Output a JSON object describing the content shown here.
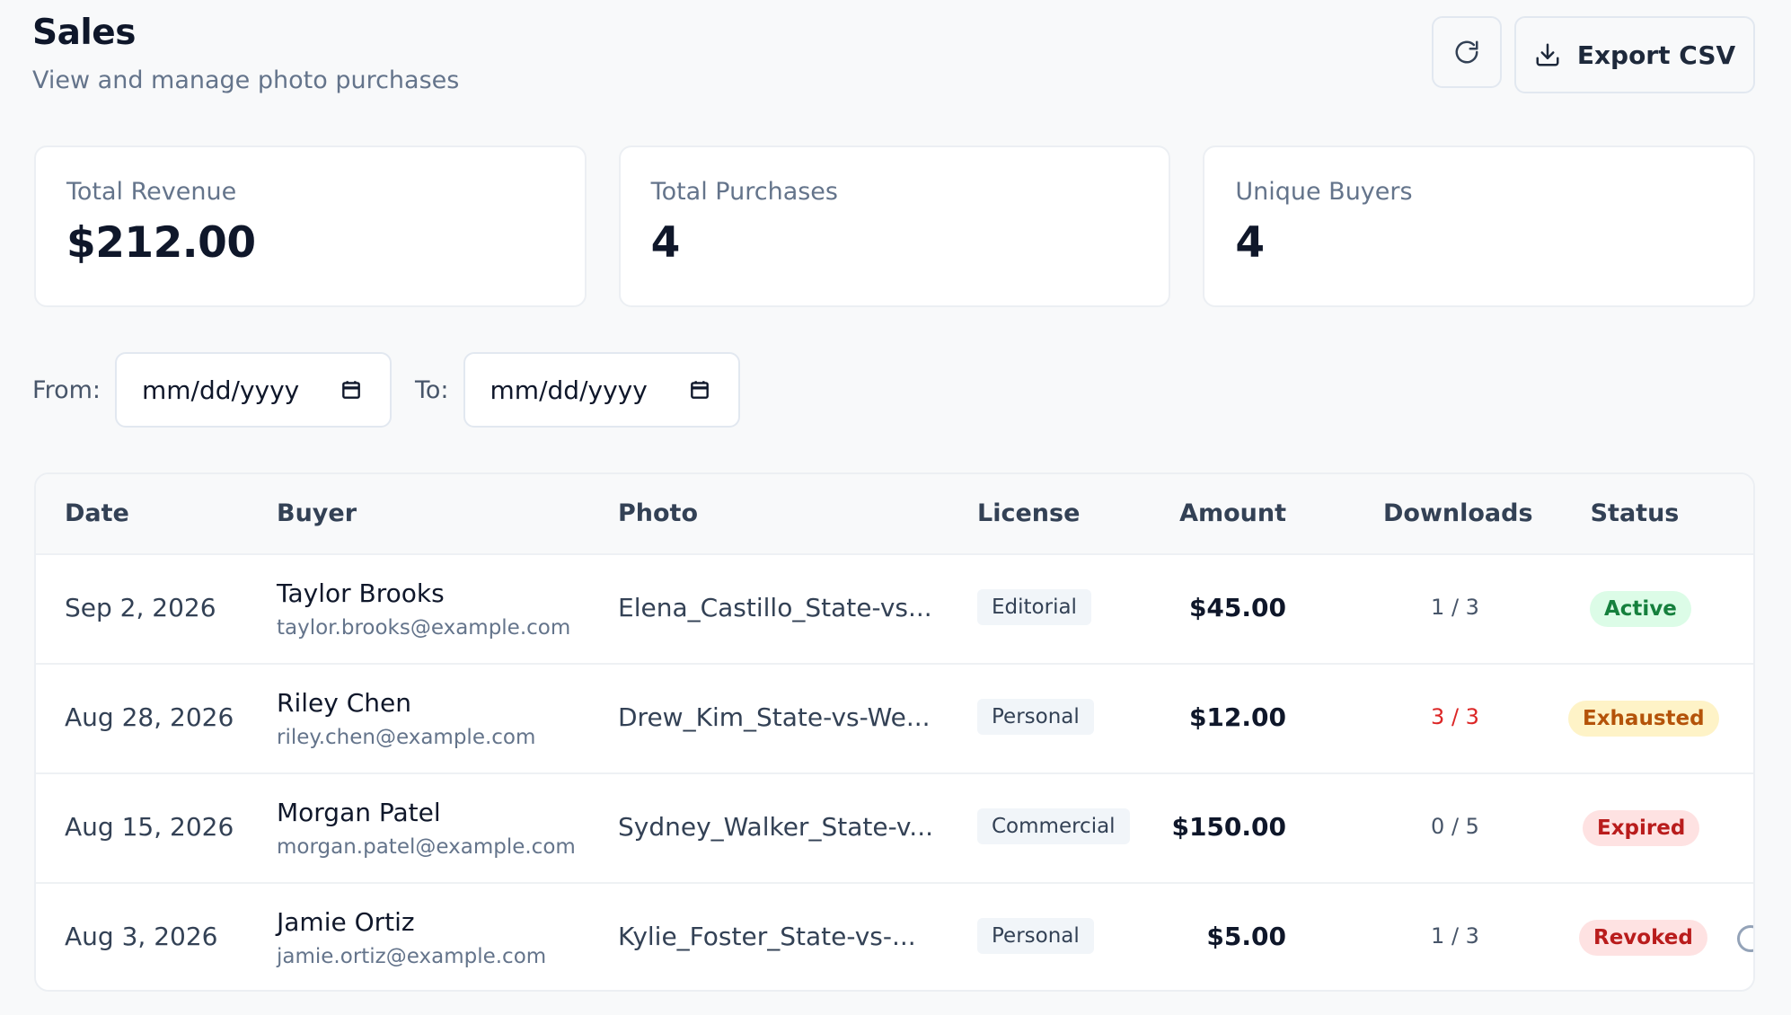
{
  "header": {
    "title": "Sales",
    "subtitle": "View and manage photo purchases",
    "refresh_icon": "refresh-icon",
    "export_label": "Export CSV",
    "export_icon": "download-icon"
  },
  "stats": [
    {
      "label": "Total Revenue",
      "value": "$212.00"
    },
    {
      "label": "Total Purchases",
      "value": "4"
    },
    {
      "label": "Unique Buyers",
      "value": "4"
    }
  ],
  "filters": {
    "from_label": "From:",
    "from_value": "mm/dd/yyyy",
    "to_label": "To:",
    "to_value": "mm/dd/yyyy",
    "calendar_icon": "calendar-icon"
  },
  "table": {
    "columns": [
      "Date",
      "Buyer",
      "Photo",
      "License",
      "Amount",
      "Downloads",
      "Status"
    ],
    "rows": [
      {
        "date": "Sep 2, 2026",
        "buyer_name": "Taylor Brooks",
        "buyer_email": "taylor.brooks@example.com",
        "photo": "Elena_Castillo_State-vs...",
        "license": "Editorial",
        "amount": "$45.00",
        "downloads": "1 / 3",
        "status": "Active"
      },
      {
        "date": "Aug 28, 2026",
        "buyer_name": "Riley Chen",
        "buyer_email": "riley.chen@example.com",
        "photo": "Drew_Kim_State-vs-We...",
        "license": "Personal",
        "amount": "$12.00",
        "downloads": "3 / 3",
        "status": "Exhausted"
      },
      {
        "date": "Aug 15, 2026",
        "buyer_name": "Morgan Patel",
        "buyer_email": "morgan.patel@example.com",
        "photo": "Sydney_Walker_State-v...",
        "license": "Commercial",
        "amount": "$150.00",
        "downloads": "0 / 5",
        "status": "Expired"
      },
      {
        "date": "Aug 3, 2026",
        "buyer_name": "Jamie Ortiz",
        "buyer_email": "jamie.ortiz@example.com",
        "photo": "Kylie_Foster_State-vs-...",
        "license": "Personal",
        "amount": "$5.00",
        "downloads": "1 / 3",
        "status": "Revoked"
      }
    ]
  },
  "colors": {
    "background": "#f8f9fa",
    "active": "#15803d",
    "exhausted": "#b45309",
    "expired": "#b91c1c",
    "revoked": "#b91c1c",
    "downloads_exhausted": "#dc2626"
  }
}
